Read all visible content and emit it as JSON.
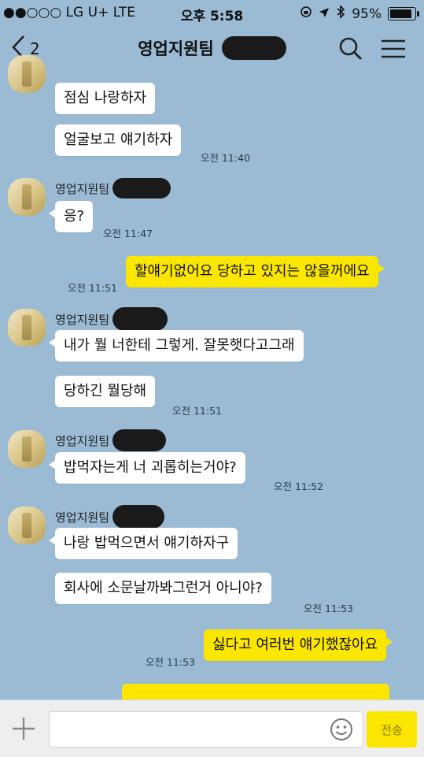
{
  "status_bar": {
    "carrier": "●●○○○ LG U+  LTE",
    "time": "오후 5:58",
    "battery": "95%",
    "battery_level": 0.95
  },
  "header": {
    "back_count": "2",
    "title": "영업지원팀",
    "icons": [
      "back-chevron-icon",
      "search-icon",
      "menu-icon"
    ]
  },
  "messages": [
    {
      "side": "left",
      "text": "점심 나랑하자"
    },
    {
      "side": "left",
      "text": "얼굴보고 얘기하자",
      "time": "오전 11:40"
    },
    {
      "side": "left",
      "sender": "영업지원팀",
      "text": "응?",
      "time": "오전 11:47"
    },
    {
      "side": "right",
      "text": "할얘기없어요 당하고 있지는 않을꺼에요",
      "time": "오전 11:51"
    },
    {
      "side": "left",
      "sender": "영업지원팀",
      "text": "내가 뭘 너한테 그렇게. 잘못햇다고그래"
    },
    {
      "side": "left",
      "text": "당하긴 뭘당해",
      "time": "오전 11:51"
    },
    {
      "side": "left",
      "sender": "영업지원팀",
      "text": "밥먹자는게 너 괴롭히는거야?",
      "time": "오전 11:52"
    },
    {
      "side": "left",
      "sender": "영업지원팀",
      "text": "나랑 밥먹으면서 얘기하자구"
    },
    {
      "side": "left",
      "text": "회사에 소문날까봐그런거 아니야?",
      "time": "오전 11:53"
    },
    {
      "side": "right",
      "text": "싫다고 여러번 얘기했잖아요",
      "time": "오전 11:53"
    }
  ],
  "input_bar": {
    "placeholder": "",
    "send_label": "전송"
  },
  "colors": {
    "background": "#9bbbd4",
    "my_bubble": "#fbe600",
    "other_bubble": "#ffffff"
  }
}
